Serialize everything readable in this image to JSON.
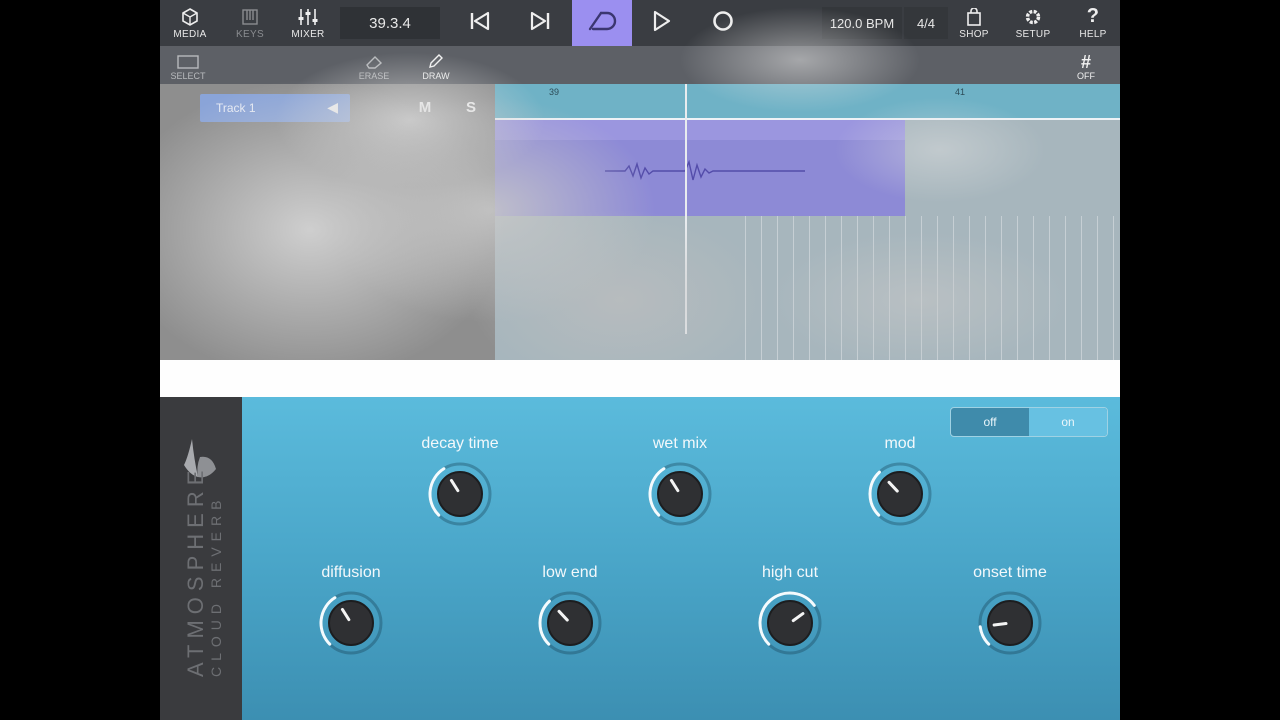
{
  "toolbar": {
    "media": "MEDIA",
    "keys": "KEYS",
    "mixer": "MIXER",
    "position": "39.3.4",
    "bpm": "120.0 BPM",
    "time_signature": "4/4",
    "shop": "SHOP",
    "setup": "SETUP",
    "help": "HELP"
  },
  "toolbar2": {
    "select": "SELECT",
    "erase": "ERASE",
    "draw": "DRAW",
    "grid": "OFF"
  },
  "arrange": {
    "track_name": "Track 1",
    "mute": "M",
    "solo": "S",
    "ruler": [
      "39",
      "41"
    ]
  },
  "plugin": {
    "name": "ATMOSPHERE",
    "subtitle": "CLOUD REVERB",
    "power": {
      "off": "off",
      "on": "on",
      "selected": "on"
    },
    "knobs": [
      {
        "label": "decay time",
        "value": 0.38
      },
      {
        "label": "wet mix",
        "value": 0.38
      },
      {
        "label": "mod",
        "value": 0.34
      },
      {
        "label": "diffusion",
        "value": 0.38
      },
      {
        "label": "low end",
        "value": 0.34
      },
      {
        "label": "high cut",
        "value": 0.7
      },
      {
        "label": "onset time",
        "value": 0.14
      }
    ]
  },
  "colors": {
    "loop_active": "#9b8ff0",
    "plugin_blue": "#4aa6c9"
  }
}
